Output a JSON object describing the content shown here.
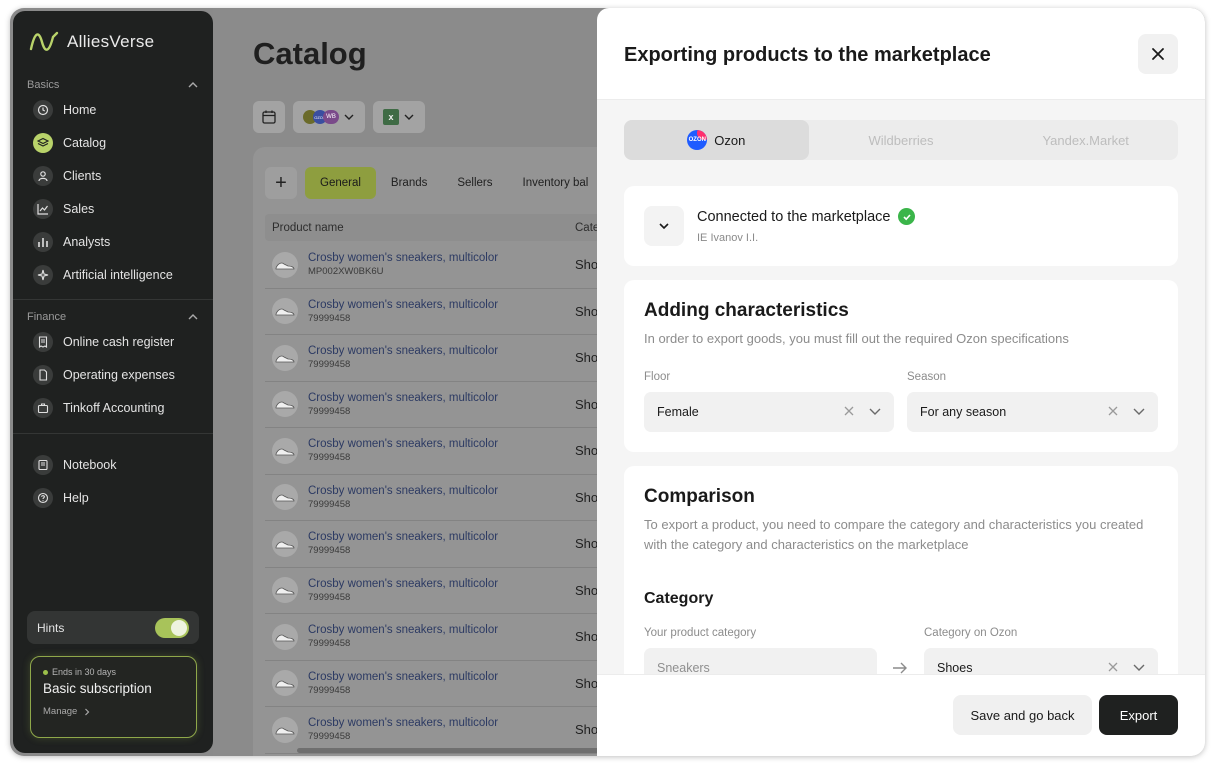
{
  "sidebar": {
    "brand": "AlliesVerse",
    "sections": {
      "basics": "Basics",
      "finance": "Finance"
    },
    "basics_items": [
      {
        "label": "Home",
        "icon": "clock-icon"
      },
      {
        "label": "Catalog",
        "icon": "layers-icon"
      },
      {
        "label": "Clients",
        "icon": "user-icon"
      },
      {
        "label": "Sales",
        "icon": "chart-line-icon"
      },
      {
        "label": "Analysts",
        "icon": "bar-chart-icon"
      },
      {
        "label": "Artificial intelligence",
        "icon": "sparkle-icon"
      }
    ],
    "finance_items": [
      {
        "label": "Online cash register",
        "icon": "receipt-icon"
      },
      {
        "label": "Operating expenses",
        "icon": "document-icon"
      },
      {
        "label": "Tinkoff Accounting",
        "icon": "briefcase-icon"
      }
    ],
    "other_items": [
      {
        "label": "Notebook",
        "icon": "notebook-icon"
      },
      {
        "label": "Help",
        "icon": "help-icon"
      }
    ],
    "hints_label": "Hints",
    "hints_on": true,
    "subscription": {
      "ends": "Ends in 30 days",
      "title": "Basic subscription",
      "manage": "Manage"
    }
  },
  "main": {
    "title": "Catalog",
    "tabs": [
      "General",
      "Brands",
      "Sellers",
      "Inventory bal"
    ],
    "columns": [
      "Product name",
      "Cate"
    ],
    "rows": [
      {
        "name": "Crosby women's sneakers, multicolor",
        "sku": "MP002XW0BK6U",
        "category": "Sho"
      },
      {
        "name": "Crosby women's sneakers, multicolor",
        "sku": "79999458",
        "category": "Sho"
      },
      {
        "name": "Crosby women's sneakers, multicolor",
        "sku": "79999458",
        "category": "Sho"
      },
      {
        "name": "Crosby women's sneakers, multicolor",
        "sku": "79999458",
        "category": "Sho"
      },
      {
        "name": "Crosby women's sneakers, multicolor",
        "sku": "79999458",
        "category": "Sho"
      },
      {
        "name": "Crosby women's sneakers, multicolor",
        "sku": "79999458",
        "category": "Sho"
      },
      {
        "name": "Crosby women's sneakers, multicolor",
        "sku": "79999458",
        "category": "Sho"
      },
      {
        "name": "Crosby women's sneakers, multicolor",
        "sku": "79999458",
        "category": "Sho"
      },
      {
        "name": "Crosby women's sneakers, multicolor",
        "sku": "79999458",
        "category": "Sho"
      },
      {
        "name": "Crosby women's sneakers, multicolor",
        "sku": "79999458",
        "category": "Sho"
      },
      {
        "name": "Crosby women's sneakers, multicolor",
        "sku": "79999458",
        "category": "Sho"
      }
    ],
    "toolbar_badge": "WB",
    "toolbar_ozon_badge": "OZON"
  },
  "drawer": {
    "title": "Exporting products to the marketplace",
    "marketplaces": [
      {
        "label": "Ozon",
        "active": true
      },
      {
        "label": "Wildberries",
        "active": false
      },
      {
        "label": "Yandex.Market",
        "active": false
      }
    ],
    "connection": {
      "title": "Connected to the marketplace",
      "subtitle": "IE Ivanov I.I."
    },
    "characteristics": {
      "title": "Adding characteristics",
      "description": "In order to export goods, you must fill out the required Ozon specifications",
      "floor_label": "Floor",
      "floor_value": "Female",
      "season_label": "Season",
      "season_value": "For any season"
    },
    "comparison": {
      "title": "Comparison",
      "description": "To export a product, you need to compare the category and characteristics you created with the category and characteristics on the marketplace",
      "category_title": "Category",
      "your_label": "Your product category",
      "your_value": "Sneakers",
      "ozon_label": "Category on Ozon",
      "ozon_value": "Shoes"
    },
    "buttons": {
      "save_back": "Save and go back",
      "export": "Export"
    }
  },
  "colors": {
    "accent": "#b9d36a",
    "sidebar_bg": "#1f2120",
    "connected": "#3bb54a",
    "ozon_blue": "#1f5cff"
  }
}
